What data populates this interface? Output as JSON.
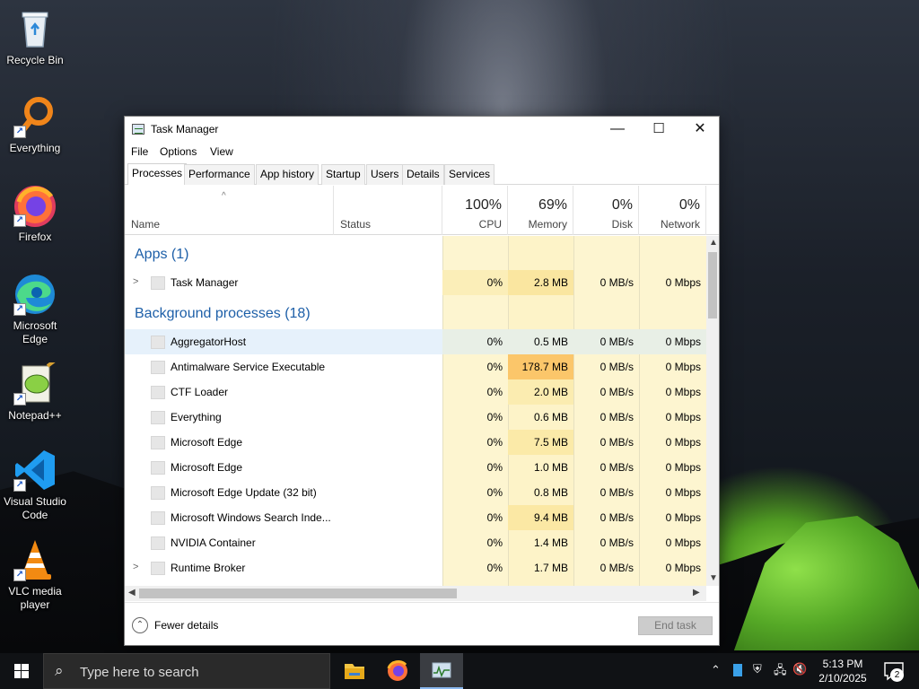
{
  "desktop": {
    "icons": [
      {
        "label": "Recycle Bin"
      },
      {
        "label": "Everything"
      },
      {
        "label": "Firefox"
      },
      {
        "label": "Microsoft Edge"
      },
      {
        "label": "Notepad++"
      },
      {
        "label": "Visual Studio Code"
      },
      {
        "label": "VLC media player"
      }
    ]
  },
  "window": {
    "title": "Task Manager",
    "controls": {
      "minimize": "—",
      "maximize": "☐",
      "close": "✕"
    },
    "menu": [
      "File",
      "Options",
      "View"
    ],
    "tabs": [
      "Processes",
      "Performance",
      "App history",
      "Startup",
      "Users",
      "Details",
      "Services"
    ],
    "active_tab": "Processes",
    "columns": {
      "name": "Name",
      "status": "Status",
      "cpu": {
        "pct": "100%",
        "label": "CPU"
      },
      "memory": {
        "pct": "69%",
        "label": "Memory"
      },
      "disk": {
        "pct": "0%",
        "label": "Disk"
      },
      "network": {
        "pct": "0%",
        "label": "Network"
      }
    },
    "groups": {
      "apps": "Apps (1)",
      "background": "Background processes (18)"
    },
    "apps": [
      {
        "name": "Task Manager",
        "cpu": "0%",
        "memory": "2.8 MB",
        "disk": "0 MB/s",
        "network": "0 Mbps",
        "expandable": true
      }
    ],
    "background": [
      {
        "name": "AggregatorHost",
        "cpu": "0%",
        "memory": "0.5 MB",
        "disk": "0 MB/s",
        "network": "0 Mbps",
        "selected": true
      },
      {
        "name": "Antimalware Service Executable",
        "cpu": "0%",
        "memory": "178.7 MB",
        "disk": "0 MB/s",
        "network": "0 Mbps",
        "hot": true
      },
      {
        "name": "CTF Loader",
        "cpu": "0%",
        "memory": "2.0 MB",
        "disk": "0 MB/s",
        "network": "0 Mbps"
      },
      {
        "name": "Everything",
        "cpu": "0%",
        "memory": "0.6 MB",
        "disk": "0 MB/s",
        "network": "0 Mbps"
      },
      {
        "name": "Microsoft Edge",
        "cpu": "0%",
        "memory": "7.5 MB",
        "disk": "0 MB/s",
        "network": "0 Mbps"
      },
      {
        "name": "Microsoft Edge",
        "cpu": "0%",
        "memory": "1.0 MB",
        "disk": "0 MB/s",
        "network": "0 Mbps"
      },
      {
        "name": "Microsoft Edge Update (32 bit)",
        "cpu": "0%",
        "memory": "0.8 MB",
        "disk": "0 MB/s",
        "network": "0 Mbps"
      },
      {
        "name": "Microsoft Windows Search Inde...",
        "cpu": "0%",
        "memory": "9.4 MB",
        "disk": "0 MB/s",
        "network": "0 Mbps"
      },
      {
        "name": "NVIDIA Container",
        "cpu": "0%",
        "memory": "1.4 MB",
        "disk": "0 MB/s",
        "network": "0 Mbps"
      },
      {
        "name": "Runtime Broker",
        "cpu": "0%",
        "memory": "1.7 MB",
        "disk": "0 MB/s",
        "network": "0 Mbps",
        "expandable": true
      }
    ],
    "footer": {
      "fewer_details": "Fewer details",
      "end_task": "End task"
    }
  },
  "taskbar": {
    "search_placeholder": "Type here to search",
    "time": "5:13 PM",
    "date": "2/10/2025",
    "notification_count": "2"
  },
  "colors": {
    "heat_light": "#fdf5d0",
    "heat_mid": "#faeaa8",
    "heat_high": "#fbc66a",
    "selected_row": "#e6f1fb",
    "group_text": "#1d5fa8"
  }
}
